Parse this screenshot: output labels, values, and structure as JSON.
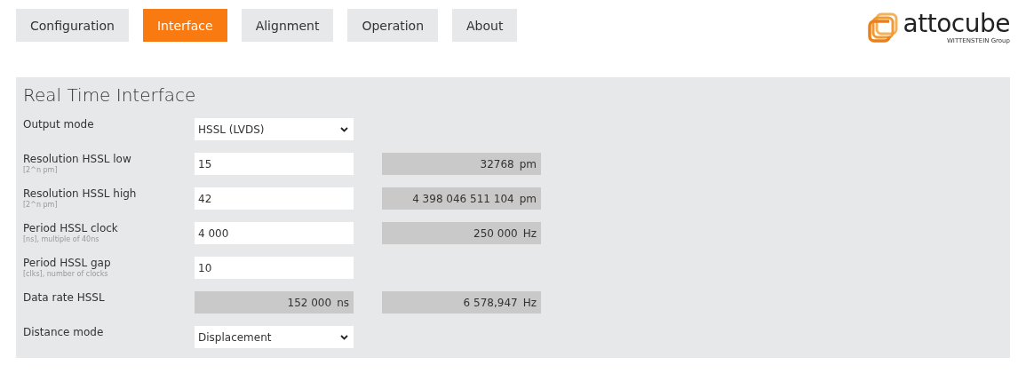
{
  "tabs": [
    {
      "label": "Configuration",
      "selected": false
    },
    {
      "label": "Interface",
      "selected": true
    },
    {
      "label": "Alignment",
      "selected": false
    },
    {
      "label": "Operation",
      "selected": false
    },
    {
      "label": "About",
      "selected": false
    }
  ],
  "logo": {
    "name": "attocube",
    "tagline": "WITTENSTEIN Group"
  },
  "panel": {
    "title": "Real Time Interface",
    "rows": [
      {
        "label": "Output mode",
        "field": {
          "kind": "select",
          "value": "HSSL (LVDS)"
        }
      },
      {
        "label": "Resolution HSSL low",
        "hint": "[2^n pm]",
        "field": {
          "kind": "input",
          "value": "15"
        },
        "readout": {
          "value": "32768",
          "unit": "pm"
        }
      },
      {
        "label": "Resolution HSSL high",
        "hint": "[2^n pm]",
        "field": {
          "kind": "input",
          "value": "42"
        },
        "readout": {
          "value": "4 398 046 511 104",
          "unit": "pm"
        }
      },
      {
        "label": "Period HSSL clock",
        "hint": "[ns], multiple of 40ns",
        "field": {
          "kind": "input",
          "value": "4 000"
        },
        "readout": {
          "value": "250 000",
          "unit": "Hz"
        }
      },
      {
        "label": "Period HSSL gap",
        "hint": "[clks], number of clocks",
        "field": {
          "kind": "input",
          "value": "10"
        }
      },
      {
        "label": "Data rate HSSL",
        "field": {
          "kind": "readout",
          "value": "152 000",
          "unit": "ns"
        },
        "readout": {
          "value": "6 578,947",
          "unit": "Hz"
        }
      },
      {
        "label": "Distance mode",
        "field": {
          "kind": "select",
          "value": "Displacement"
        }
      }
    ]
  }
}
